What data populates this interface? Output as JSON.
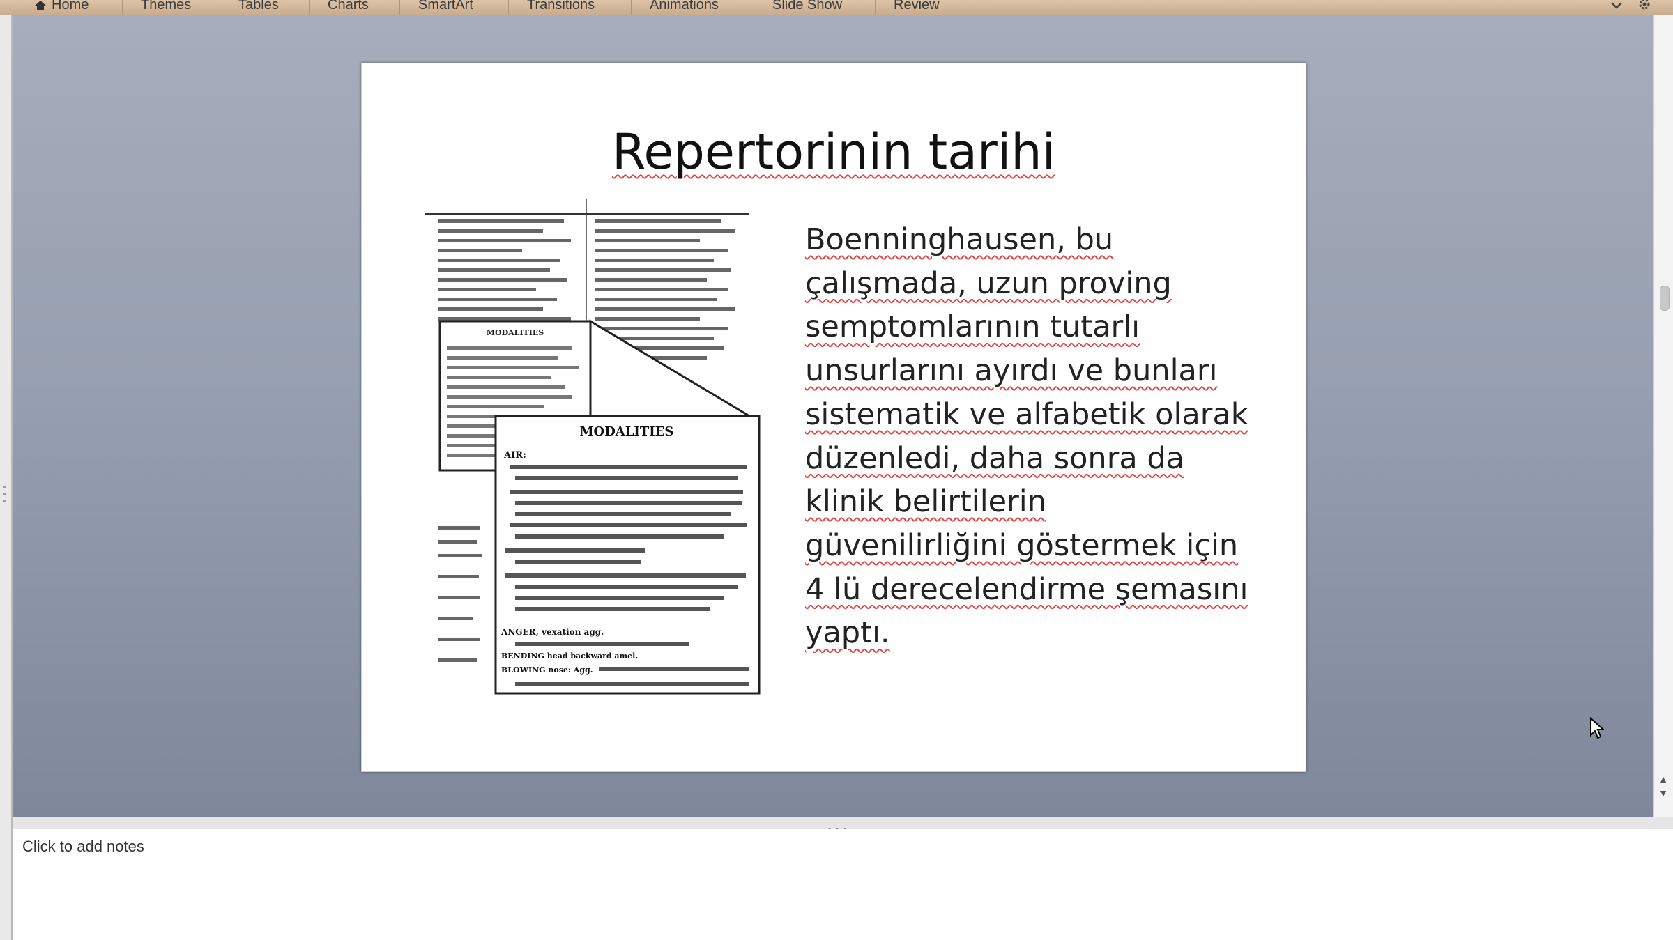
{
  "ribbon": {
    "tabs": [
      {
        "label": "Home",
        "icon": "home-icon"
      },
      {
        "label": "Themes"
      },
      {
        "label": "Tables"
      },
      {
        "label": "Charts"
      },
      {
        "label": "SmartArt"
      },
      {
        "label": "Transitions"
      },
      {
        "label": "Animations"
      },
      {
        "label": "Slide Show"
      },
      {
        "label": "Review"
      }
    ],
    "right_icons": [
      "collapse-ribbon-icon",
      "gear-icon"
    ]
  },
  "slide": {
    "title": "Repertorinin tarihi",
    "body_lines": [
      "Boenninghausen, bu",
      "çalışmada, uzun proving",
      "semptomlarının tutarlı",
      "unsurlarını ayırdı ve bunları",
      "sistematik ve alfabetik olarak",
      "düzenledi, daha sonra da",
      "klinik belirtilerin",
      "güvenilirliğini göstermek için",
      "4 lü derecelendirme şemasını",
      "yaptı."
    ],
    "image": {
      "heading": "MODALITIES",
      "small_heading": "MODALITIES",
      "entries": [
        "AIR:",
        "ANGER, vexation agg.",
        "BENDING head backward amel.",
        "BLOWING nose: Agg."
      ]
    }
  },
  "notes": {
    "placeholder": "Click to add notes"
  },
  "colors": {
    "ribbon": "#d2b699",
    "canvas_top": "#a6adbc",
    "canvas_bottom": "#7f889a",
    "spell_underline": "#e04848"
  }
}
